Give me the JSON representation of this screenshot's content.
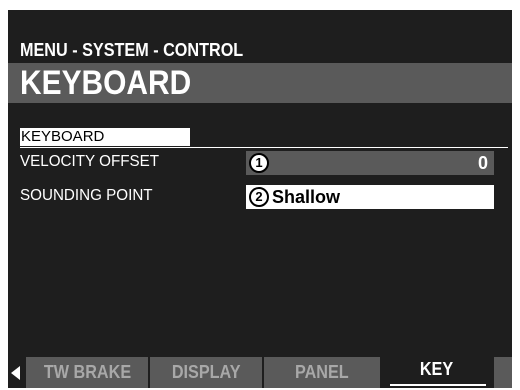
{
  "header": {
    "breadcrumb": "MENU - SYSTEM - CONTROL",
    "title": "KEYBOARD"
  },
  "section": {
    "label": "KEYBOARD"
  },
  "parameters": [
    {
      "number": "1",
      "label": "VELOCITY OFFSET",
      "value": "0"
    },
    {
      "number": "2",
      "label": "SOUNDING POINT",
      "value": "Shallow"
    }
  ],
  "tabs": [
    {
      "label": "TW BRAKE"
    },
    {
      "label": "DISPLAY"
    },
    {
      "label": "PANEL"
    },
    {
      "label": "KEY",
      "selected": true
    }
  ],
  "colors": {
    "background": "#1e1e1e",
    "bar": "#5a5a5a",
    "highlight": "#ffffff",
    "tab_inactive_text": "#a8a8a8"
  },
  "icons": {
    "tab_scroll": "left-arrow-icon"
  }
}
